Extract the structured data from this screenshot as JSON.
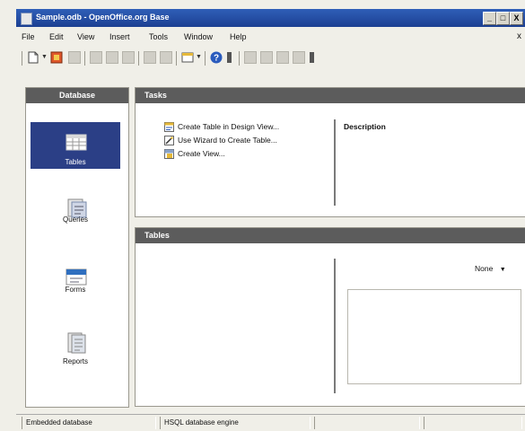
{
  "window": {
    "title": "Sample.odb - OpenOffice.org Base",
    "controls": [
      "_",
      "□",
      "X"
    ],
    "close_document": "x"
  },
  "menu": [
    "File",
    "Edit",
    "View",
    "Insert",
    "Tools",
    "Window",
    "Help"
  ],
  "toolbar": {
    "icons": [
      "new-document-icon",
      "open-folder-icon",
      "save-icon",
      "cut-icon",
      "copy-icon",
      "paste-icon",
      "sort-ascending-icon",
      "sort-descending-icon",
      "form-icon",
      "help-icon",
      "report-icon",
      "table-icon",
      "query-icon",
      "form-design-icon",
      "print-icon",
      "navigator-icon"
    ]
  },
  "sidebar": {
    "header": "Database",
    "items": [
      {
        "label": "Tables",
        "icon": "tables-icon",
        "selected": true
      },
      {
        "label": "Queries",
        "icon": "queries-icon",
        "selected": false
      },
      {
        "label": "Forms",
        "icon": "forms-icon",
        "selected": false
      },
      {
        "label": "Reports",
        "icon": "reports-icon",
        "selected": false
      }
    ]
  },
  "tasks": {
    "header": "Tasks",
    "items": [
      {
        "label": "Create Table in Design View...",
        "icon": "design-view-icon"
      },
      {
        "label": "Use Wizard to Create Table...",
        "icon": "wizard-icon"
      },
      {
        "label": "Create View...",
        "icon": "view-icon"
      }
    ],
    "description_label": "Description"
  },
  "tables": {
    "header": "Tables",
    "preview_mode": "None"
  },
  "status": {
    "cells": [
      "Embedded database",
      "HSQL database engine",
      "",
      ""
    ]
  },
  "colors": {
    "titlebar": "#1c3f91",
    "panel_header": "#5c5c5c",
    "selected_item": "#2b3f86",
    "window_bg": "#f0efe8"
  }
}
